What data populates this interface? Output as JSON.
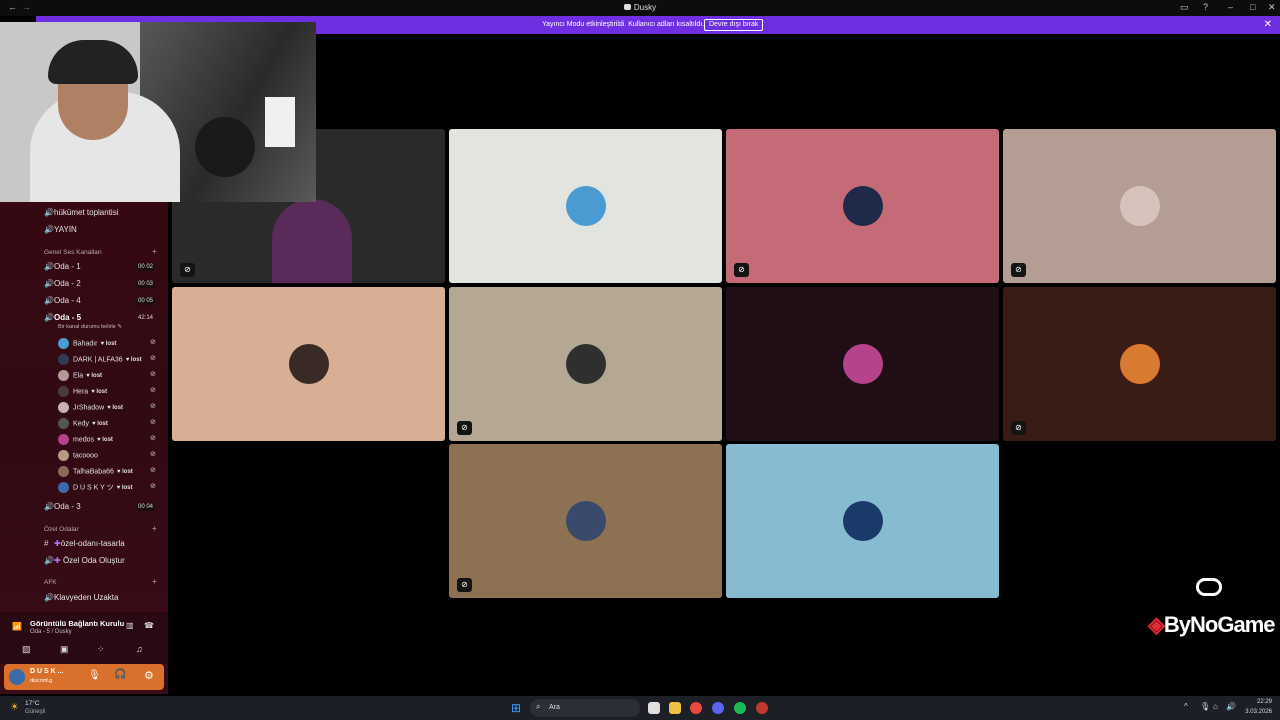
{
  "window": {
    "title": "Dusky"
  },
  "banner": {
    "message": "Yayıncı Modu etkinleştirildi. Kullanıcı adları kısaltıldı.",
    "button": "Devre dışı bırak",
    "close": "✕"
  },
  "sidebar": {
    "channels_top": [
      {
        "label": "hükümet toplantisi"
      },
      {
        "label": "YAYIN"
      }
    ],
    "category_voice": "Genel Ses Kanalları",
    "rooms": [
      {
        "label": "Oda - 1",
        "count": "00 02"
      },
      {
        "label": "Oda - 2",
        "count": "00 03"
      },
      {
        "label": "Oda - 4",
        "count": "00 05"
      }
    ],
    "active_room": {
      "label": "Oda - 5",
      "time": "42:14",
      "status": "Bir kanal durumu belirle"
    },
    "members": [
      {
        "name": "Bahadır",
        "tag": "lost",
        "color": "#4a9bd1"
      },
      {
        "name": "DARK | ALFA36",
        "tag": "lost",
        "color": "#333a55"
      },
      {
        "name": "Ela",
        "tag": "lost",
        "color": "#b39a94"
      },
      {
        "name": "Hera",
        "tag": "lost",
        "color": "#4a3a38"
      },
      {
        "name": "JrShadow",
        "tag": "lost",
        "color": "#c9b0b8"
      },
      {
        "name": "Kedy",
        "tag": "lost",
        "color": "#555555"
      },
      {
        "name": "medos",
        "tag": "lost",
        "color": "#b5428a"
      },
      {
        "name": "tacoooo",
        "tag": "",
        "color": "#b79a86"
      },
      {
        "name": "TalhaBaba66",
        "tag": "lost",
        "color": "#8a6a5a"
      },
      {
        "name": "D U S K Y ツ",
        "tag": "lost",
        "color": "#3a6aa8"
      }
    ],
    "room_3": {
      "label": "Oda - 3",
      "count": "00 04"
    },
    "category_private": "Özel Odalar",
    "private": [
      {
        "label": "özel-odanı-tasarla"
      },
      {
        "label": "Özel Oda Oluştur"
      }
    ],
    "category_afk": "AFK",
    "afk_channel": "Klavyeden Uzakta"
  },
  "voice_panel": {
    "status": "Görüntülü Bağlantı Kurulu",
    "location": "Oda - 5 / Dusky"
  },
  "user_bar": {
    "name": "D U S K ...",
    "sub": "discord.g"
  },
  "tiles": [
    {
      "bg": "#2a2a2a",
      "avatar": "#5a2a5a",
      "muted": true
    },
    {
      "bg": "#e2e4df",
      "avatar": "#4a9bd1",
      "muted": false
    },
    {
      "bg": "#c56b78",
      "avatar": "#1f2a4a",
      "muted": true
    },
    {
      "bg": "#b49d92",
      "avatar": "#d8c3bc",
      "muted": true
    },
    {
      "bg": "#d8ae94",
      "avatar": "#3a2a26",
      "muted": false
    },
    {
      "bg": "#b4a895",
      "avatar": "#2f2f2f",
      "muted": true
    },
    {
      "bg": "#1f0e16",
      "avatar": "#b5428a",
      "muted": false
    },
    {
      "bg": "#3a1c16",
      "avatar": "#d87a30",
      "muted": true
    },
    {
      "bg": "#8c7153",
      "avatar": "#3a4a6a",
      "muted": true
    },
    {
      "bg": "#86bbd0",
      "avatar": "#1a3a6a",
      "muted": false
    }
  ],
  "watermark": {
    "text": "ByNoGame"
  },
  "taskbar": {
    "weather_temp": "17°C",
    "weather_desc": "Güneşli",
    "search": "Ara",
    "time": "22:29",
    "date": "3.03.2026"
  }
}
